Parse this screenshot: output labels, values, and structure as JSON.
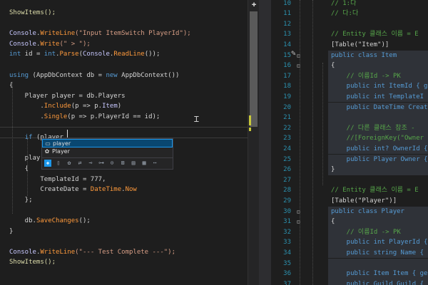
{
  "left_editor": {
    "lines": [
      {
        "segments": [
          [
            "ShowItems();",
            "#dcdcaa"
          ]
        ]
      },
      {
        "segments": []
      },
      {
        "segments": [
          [
            "Console",
            "#c8c8ff"
          ],
          [
            ".",
            ""
          ],
          [
            "WriteLine",
            "#ff9a3c"
          ],
          [
            "(\"Input ItemSwitch PlayerId\");",
            "#d69d85"
          ]
        ]
      },
      {
        "segments": [
          [
            "Console",
            "#c8c8ff"
          ],
          [
            ".",
            ""
          ],
          [
            "Write",
            "#ff9a3c"
          ],
          [
            "(\" > \");",
            "#d69d85"
          ]
        ]
      },
      {
        "segments": [
          [
            "int",
            "#569cd6"
          ],
          [
            " id = ",
            ""
          ],
          [
            "int",
            "#569cd6"
          ],
          [
            ".",
            ""
          ],
          [
            "Parse",
            "#ff9a3c"
          ],
          [
            "(",
            ""
          ],
          [
            "Console",
            "#c8c8ff"
          ],
          [
            ".",
            ""
          ],
          [
            "ReadLine",
            "#ff9a3c"
          ],
          [
            "());",
            ""
          ]
        ]
      },
      {
        "segments": []
      },
      {
        "segments": [
          [
            "using",
            "#569cd6"
          ],
          [
            " (AppDbContext db = ",
            ""
          ],
          [
            "new",
            "#569cd6"
          ],
          [
            " AppDbContext())",
            ""
          ]
        ]
      },
      {
        "segments": [
          [
            "{",
            ""
          ]
        ]
      },
      {
        "segments": [
          [
            "    Player player = db.Players",
            ""
          ]
        ]
      },
      {
        "segments": [
          [
            "        .",
            ""
          ],
          [
            "Include",
            "#ff9a3c"
          ],
          [
            "(p => p.",
            ""
          ],
          [
            "Item",
            "#c8c8ff"
          ],
          [
            ")",
            ""
          ]
        ]
      },
      {
        "segments": [
          [
            "        .",
            ""
          ],
          [
            "Single",
            "#ff9a3c"
          ],
          [
            "(p => p.PlayerId == id);",
            ""
          ]
        ]
      },
      {
        "segments": []
      },
      {
        "segments": [
          [
            "    ",
            ""
          ],
          [
            "if",
            "#569cd6"
          ],
          [
            " (player",
            ""
          ],
          [
            "",
            ""
          ]
        ]
      },
      {
        "segments": []
      },
      {
        "segments": [
          [
            "    play",
            ""
          ]
        ]
      },
      {
        "segments": [
          [
            "    {",
            ""
          ]
        ]
      },
      {
        "segments": [
          [
            "        TemplateId = 777,",
            ""
          ]
        ]
      },
      {
        "segments": [
          [
            "        CreateDate = ",
            ""
          ],
          [
            "DateTime",
            "#ff9a3c"
          ],
          [
            ".",
            ""
          ],
          [
            "Now",
            "#ff9a3c"
          ]
        ]
      },
      {
        "segments": [
          [
            "    };",
            ""
          ]
        ]
      },
      {
        "segments": []
      },
      {
        "segments": [
          [
            "    db.",
            ""
          ],
          [
            "SaveChanges",
            "#ff9a3c"
          ],
          [
            "();",
            ""
          ]
        ]
      },
      {
        "segments": [
          [
            "}",
            ""
          ]
        ]
      },
      {
        "segments": []
      },
      {
        "segments": [
          [
            "Console",
            "#c8c8ff"
          ],
          [
            ".",
            ""
          ],
          [
            "WriteLine",
            "#ff9a3c"
          ],
          [
            "(\"--- Test Complete ---\");",
            "#d69d85"
          ]
        ]
      },
      {
        "segments": [
          [
            "ShowItems();",
            "#dcdcaa"
          ]
        ]
      }
    ]
  },
  "autocomplete": {
    "items": [
      {
        "icon": "▭",
        "label": "player"
      },
      {
        "icon": "✿",
        "label": "Player"
      }
    ],
    "filter_icons": [
      "✚",
      "▯",
      "✿",
      "⇄",
      "⊸",
      "⊶",
      "⊙",
      "⊠",
      "▤",
      "▦",
      "⋯"
    ]
  },
  "right_editor": {
    "lines": [
      {
        "num": "10",
        "text": "// 1:다",
        "color": "#57a64a",
        "hl": false
      },
      {
        "num": "11",
        "text": "// 다:다",
        "color": "#57a64a",
        "hl": false
      },
      {
        "num": "12",
        "text": "",
        "color": "#d4d4d4",
        "hl": false
      },
      {
        "num": "13",
        "text": "// Entity 클래스 이름 = E",
        "color": "#57a64a",
        "hl": false
      },
      {
        "num": "14",
        "text": "[Table(\"Item\")]",
        "color": "#d4d4d4",
        "hl": false
      },
      {
        "num": "15",
        "text": "public class Item",
        "color": "#569cd6",
        "hl": true
      },
      {
        "num": "16",
        "text": "{",
        "color": "#d4d4d4",
        "hl": true
      },
      {
        "num": "17",
        "text": "    // 이름Id -> PK",
        "color": "#57a64a",
        "hl": true
      },
      {
        "num": "18",
        "text": "    public int ItemId { g",
        "color": "#569cd6",
        "hl": true
      },
      {
        "num": "19",
        "text": "    public int TemplateI",
        "color": "#569cd6",
        "hl": true
      },
      {
        "num": "20",
        "text": "    public DateTime Creat",
        "color": "#569cd6",
        "hl": true
      },
      {
        "num": "21",
        "text": "",
        "color": "#d4d4d4",
        "hl": true
      },
      {
        "num": "22",
        "text": "    // 다른 클래스 참조 -",
        "color": "#57a64a",
        "hl": true
      },
      {
        "num": "23",
        "text": "    //[ForeignKey(\"Owner",
        "color": "#57a64a",
        "hl": true
      },
      {
        "num": "24",
        "text": "    public int? OwnerId {",
        "color": "#569cd6",
        "hl": true
      },
      {
        "num": "25",
        "text": "    public Player Owner {",
        "color": "#569cd6",
        "hl": true
      },
      {
        "num": "26",
        "text": "}",
        "color": "#d4d4d4",
        "hl": true
      },
      {
        "num": "27",
        "text": "",
        "color": "#d4d4d4",
        "hl": false
      },
      {
        "num": "28",
        "text": "// Entity 클래스 이름 = E",
        "color": "#57a64a",
        "hl": false
      },
      {
        "num": "29",
        "text": "[Table(\"Player\")]",
        "color": "#d4d4d4",
        "hl": false
      },
      {
        "num": "30",
        "text": "public class Player",
        "color": "#569cd6",
        "hl": true
      },
      {
        "num": "31",
        "text": "{",
        "color": "#d4d4d4",
        "hl": true
      },
      {
        "num": "32",
        "text": "    // 이름Id -> PK",
        "color": "#57a64a",
        "hl": true
      },
      {
        "num": "33",
        "text": "    public int PlayerId {",
        "color": "#569cd6",
        "hl": true
      },
      {
        "num": "34",
        "text": "    public string Name {",
        "color": "#569cd6",
        "hl": true
      },
      {
        "num": "35",
        "text": "",
        "color": "#d4d4d4",
        "hl": true
      },
      {
        "num": "36",
        "text": "    public Item Item { ge",
        "color": "#569cd6",
        "hl": true
      },
      {
        "num": "37",
        "text": "    public Guild Guild {",
        "color": "#569cd6",
        "hl": true
      }
    ]
  }
}
